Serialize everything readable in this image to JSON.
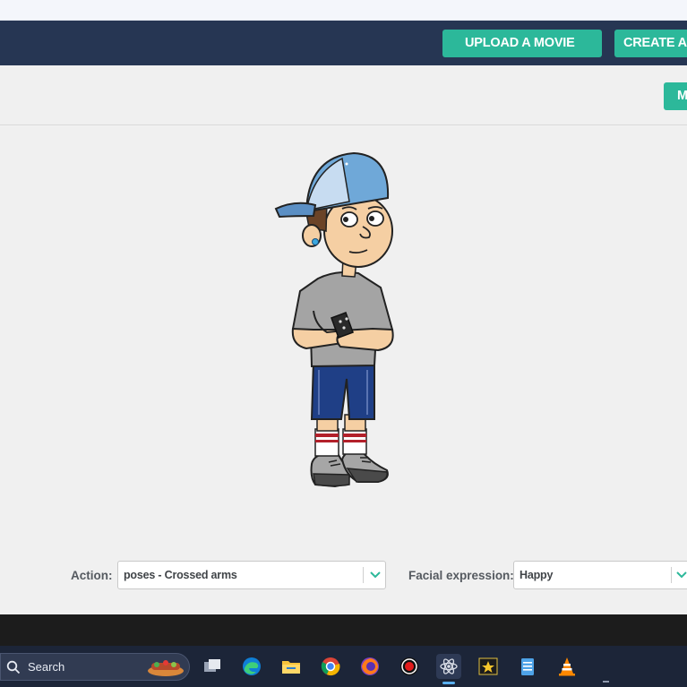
{
  "header": {
    "upload_label": "UPLOAD A MOVIE",
    "create_label": "CREATE A"
  },
  "toolbar": {
    "partial_button_label": "M"
  },
  "stage": {
    "character_name": "character-preview"
  },
  "controls": {
    "action_label": "Action:",
    "action_value": "poses - Crossed arms",
    "facial_label": "Facial expression:",
    "facial_value": "Happy"
  },
  "taskbar": {
    "search_label": "Search",
    "icons": [
      "task-view-icon",
      "edge-icon",
      "file-explorer-icon",
      "chrome-icon",
      "firefox-icon",
      "record-icon",
      "react-app-icon",
      "movie-maker-icon",
      "notepad-icon",
      "vlc-icon"
    ]
  },
  "colors": {
    "nav_bg": "#263653",
    "accent": "#2cb89a",
    "taskbar_bg": "#1c2538"
  }
}
